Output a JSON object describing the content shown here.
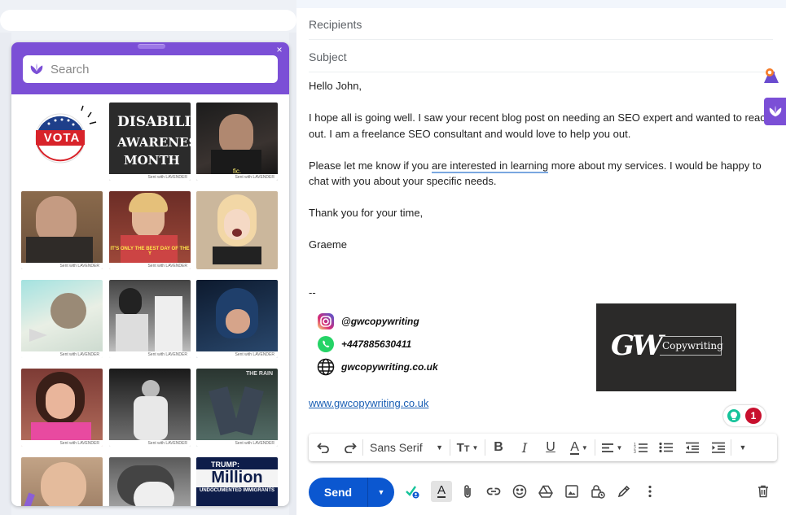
{
  "gif_panel": {
    "search_placeholder": "Search",
    "close_label": "×",
    "gifs": [
      {
        "label": "VOTA",
        "caption": ""
      },
      {
        "label": "Disability Awareness Month",
        "line1": "DISABILITY",
        "line2": "AWARENESS",
        "line3": "MONTH",
        "caption": "Sent with LAVENDER"
      },
      {
        "label": "man in studio",
        "subtitle": "fic.",
        "caption": "Sent with LAVENDER"
      },
      {
        "label": "old man laughing",
        "caption": "Sent with LAVENDER"
      },
      {
        "label": "woman party",
        "overlay": "IT'S ONLY THE BEST DAY OF THE Y",
        "caption": "Sent with LAVENDER"
      },
      {
        "label": "woman excited",
        "caption": "Sent with LAVENDER"
      },
      {
        "label": "woman relaxing",
        "caption": "Sent with LAVENDER"
      },
      {
        "label": "baseball players",
        "caption": "Sent with LAVENDER"
      },
      {
        "label": "hero in mask",
        "caption": "Sent with LAVENDER"
      },
      {
        "label": "woman frustrated",
        "caption": "Sent with LAVENDER"
      },
      {
        "label": "dancing couple",
        "caption": "Sent with LAVENDER"
      },
      {
        "label": "The Rain",
        "overlay": "THE RAIN",
        "caption": "Sent with LAVENDER"
      },
      {
        "label": "woman smiling",
        "caption": ""
      },
      {
        "label": "hugging",
        "caption": ""
      },
      {
        "label": "Trump Million",
        "line1": "TRUMP:",
        "line2": "Million",
        "line3": "UNDOCUMENTED IMMIGRANTS",
        "caption": ""
      }
    ]
  },
  "compose": {
    "recipients_placeholder": "Recipients",
    "subject_placeholder": "Subject",
    "body": {
      "greeting": "Hello John,",
      "para1": "I hope all is going well. I saw your recent blog post on needing an SEO expert and wanted to reach out. I am a freelance SEO consultant and would love to help you out.",
      "para2_before": "Please let me know if you ",
      "para2_underlined": "are interested in learning",
      "para2_after": " more about my services. I would be happy to chat with you about your specific needs.",
      "thanks": "Thank you for your time,",
      "name": "Graeme"
    },
    "signature": {
      "divider": "--",
      "instagram": "@gwcopywriting",
      "whatsapp": "+447885630411",
      "website": "gwcopywriting.co.uk",
      "logo_mark": "GW",
      "logo_text": "Copywriting",
      "link": "www.gwcopywriting.co.uk"
    },
    "grammar_badge_count": "1",
    "format_bar": {
      "font": "Sans Serif"
    },
    "send_label": "Send"
  },
  "colors": {
    "lavender": "#7b4fd6",
    "send_blue": "#0b57d0",
    "link_blue": "#1a5fb4",
    "badge_red": "#c8102e",
    "grammarly_green": "#15c39a"
  }
}
